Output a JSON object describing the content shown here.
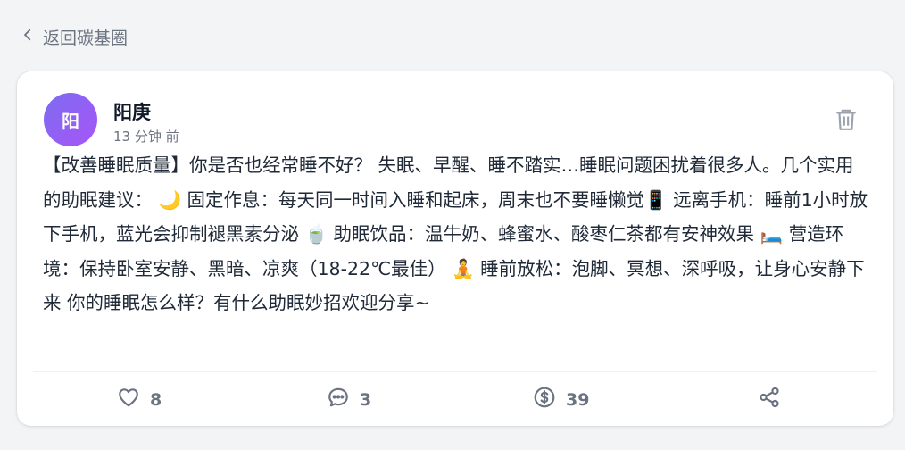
{
  "nav": {
    "back_label": "返回碳基圈"
  },
  "post": {
    "avatar_text": "阳",
    "author": "阳庚",
    "time": "13 分钟 前",
    "content": "【改善睡眠质量】你是否也经常睡不好？ 失眠、早醒、睡不踏实…睡眠问题困扰着很多人。几个实用的助眠建议： 🌙 固定作息：每天同一时间入睡和起床，周末也不要睡懒觉📱 远离手机：睡前1小时放下手机，蓝光会抑制褪黑素分泌 🍵 助眠饮品：温牛奶、蜂蜜水、酸枣仁茶都有安神效果 🛏️ 营造环境：保持卧室安静、黑暗、凉爽（18-22℃最佳） 🧘 睡前放松：泡脚、冥想、深呼吸，让身心安静下来 你的睡眠怎么样？有什么助眠妙招欢迎分享~"
  },
  "actions": {
    "likes": "8",
    "comments": "3",
    "tips": "39"
  },
  "icons": {
    "back": "chevron-left-icon",
    "delete": "trash-icon",
    "like": "heart-icon",
    "comment": "comment-bubble-icon",
    "tip": "dollar-circle-icon",
    "share": "share-icon"
  },
  "colors": {
    "avatar_gradient_start": "#7c6cf0",
    "avatar_gradient_end": "#a855f7",
    "muted": "#6b7280",
    "text": "#1f2937"
  }
}
